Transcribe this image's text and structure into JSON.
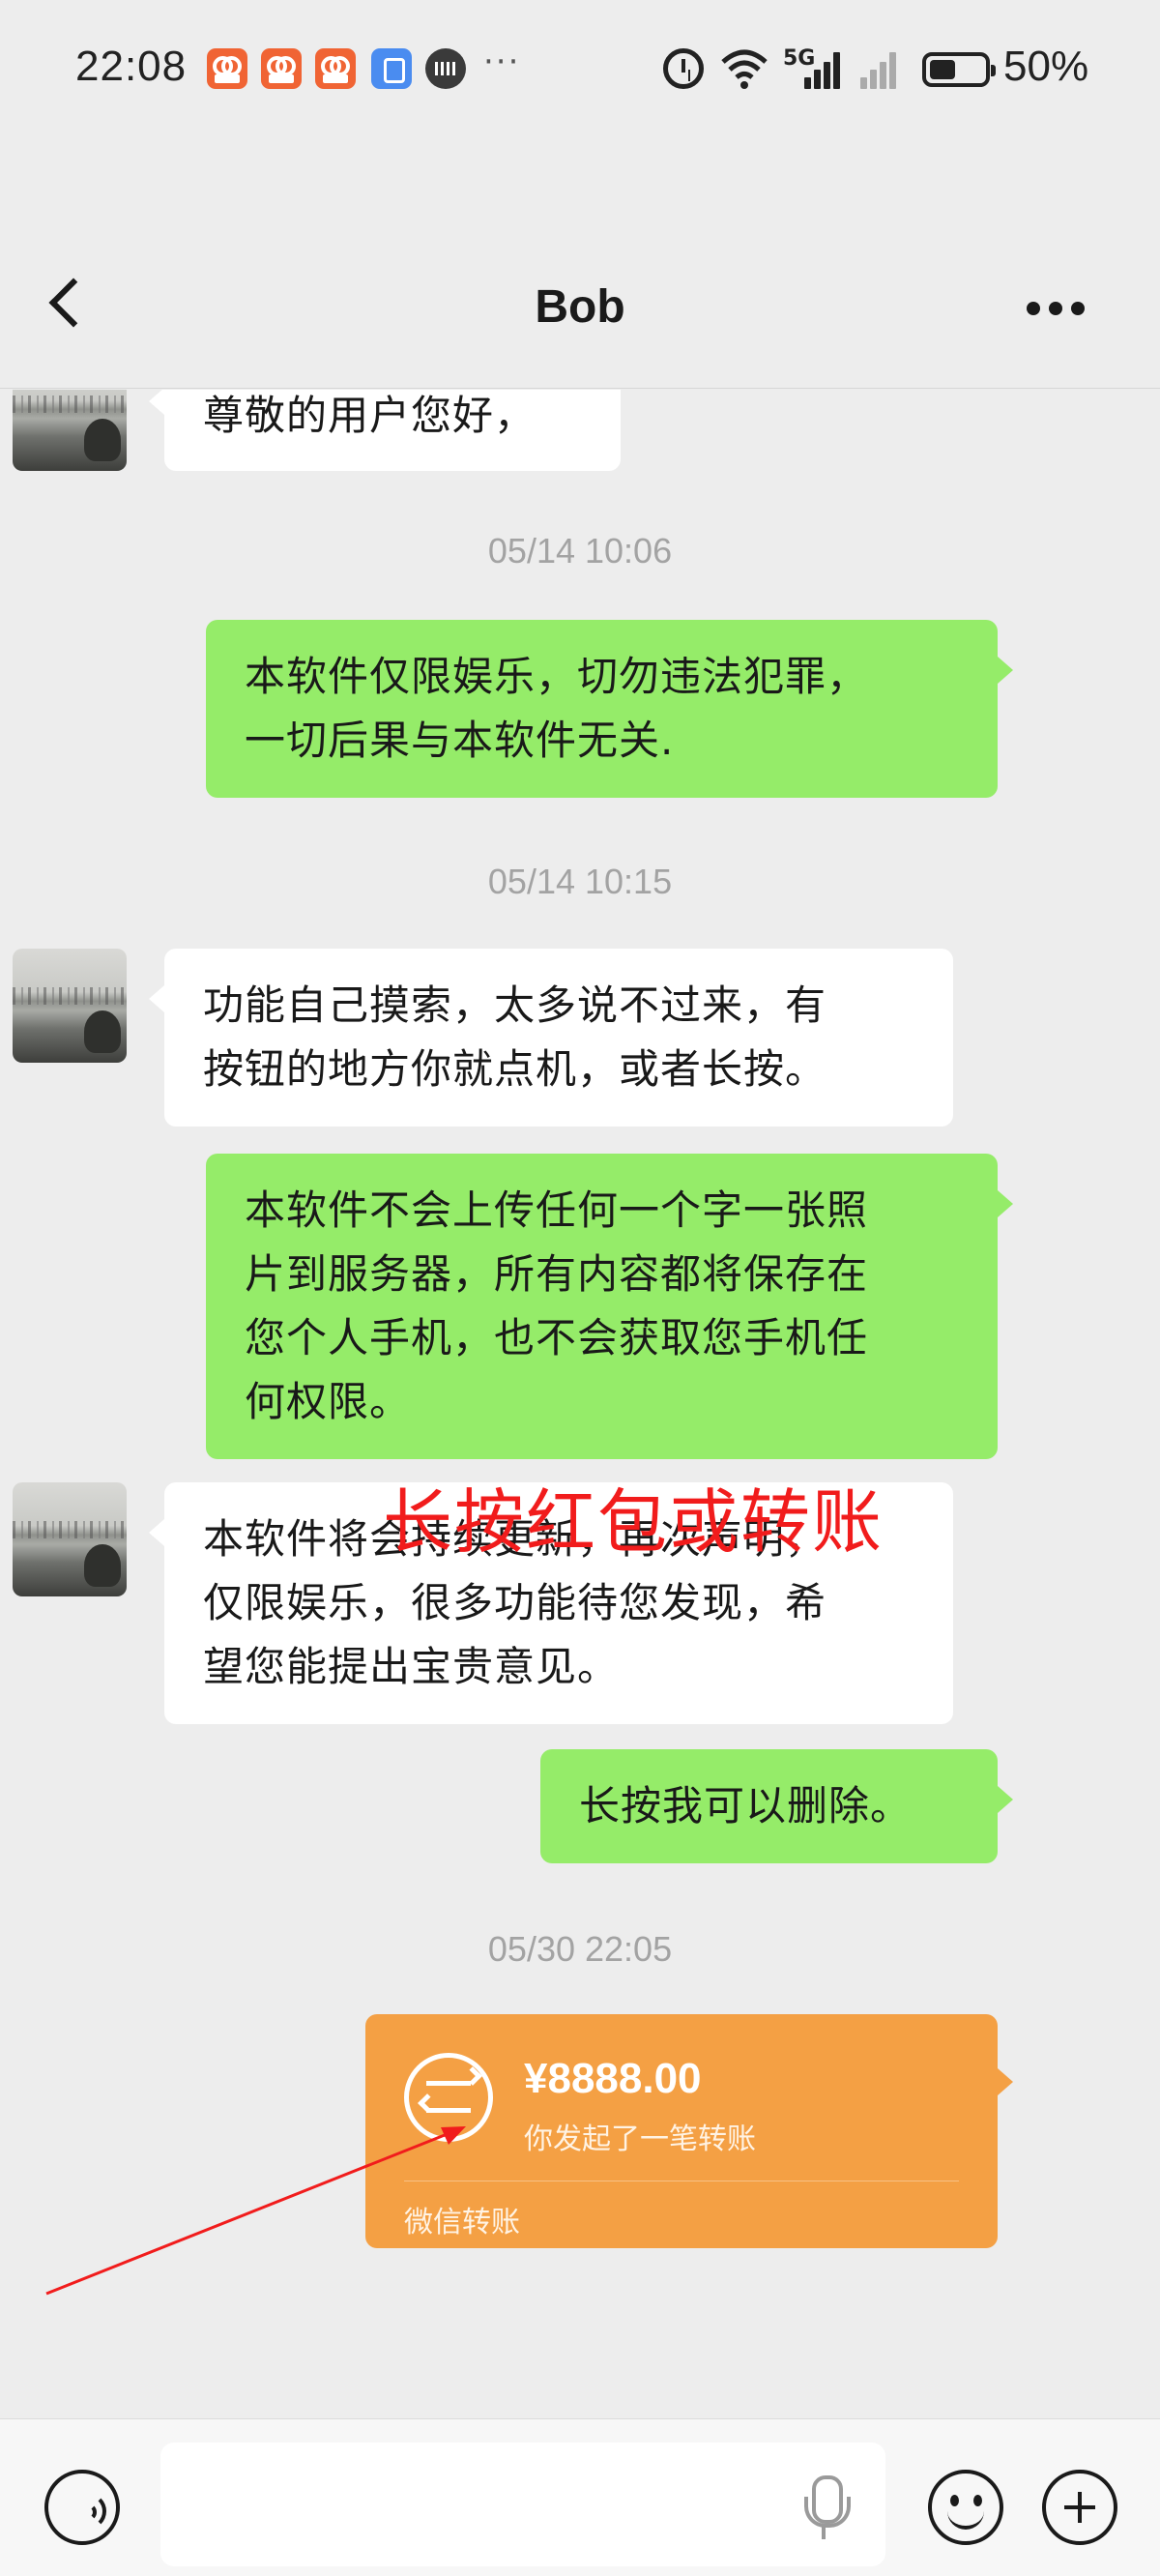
{
  "status_bar": {
    "time": "22:08",
    "network": "5G",
    "battery": "50%"
  },
  "nav": {
    "title": "Bob"
  },
  "messages": [
    {
      "side": "left",
      "text": "尊敬的用户您好，"
    },
    {
      "type": "time",
      "text": "05/14 10:06"
    },
    {
      "side": "right",
      "line1": "本软件仅限娱乐，切勿违法犯罪，",
      "line2": "一切后果与本软件无关."
    },
    {
      "type": "time",
      "text": "05/14 10:15"
    },
    {
      "side": "left",
      "line1": "功能自己摸索，太多说不过来，有",
      "line2": "按钮的地方你就点机，或者长按。"
    },
    {
      "side": "right",
      "line1": "本软件不会上传任何一个字一张照",
      "line2": "片到服务器，所有内容都将保存在",
      "line3": "您个人手机，也不会获取您手机任",
      "line4": "何权限。"
    },
    {
      "side": "left",
      "line1": "本软件将会持续更新，再次声明，",
      "line2": "仅限娱乐，很多功能待您发现，希",
      "line3": "望您能提出宝贵意见。"
    },
    {
      "side": "right",
      "text": "长按我可以删除。"
    },
    {
      "type": "time",
      "text": "05/30 22:05"
    }
  ],
  "overlay_note": "长按红包或转账",
  "transfer": {
    "amount": "¥8888.00",
    "description": "你发起了一笔转账",
    "footer": "微信转账"
  },
  "colors": {
    "background": "#ededed",
    "bubble_self": "#95ec69",
    "bubble_other": "#ffffff",
    "transfer": "#f4a044",
    "annotation": "#f11c1c"
  },
  "icons": [
    "back-icon",
    "more-icon",
    "voice-icon",
    "microphone-icon",
    "emoji-icon",
    "plus-icon",
    "transfer-icon"
  ]
}
